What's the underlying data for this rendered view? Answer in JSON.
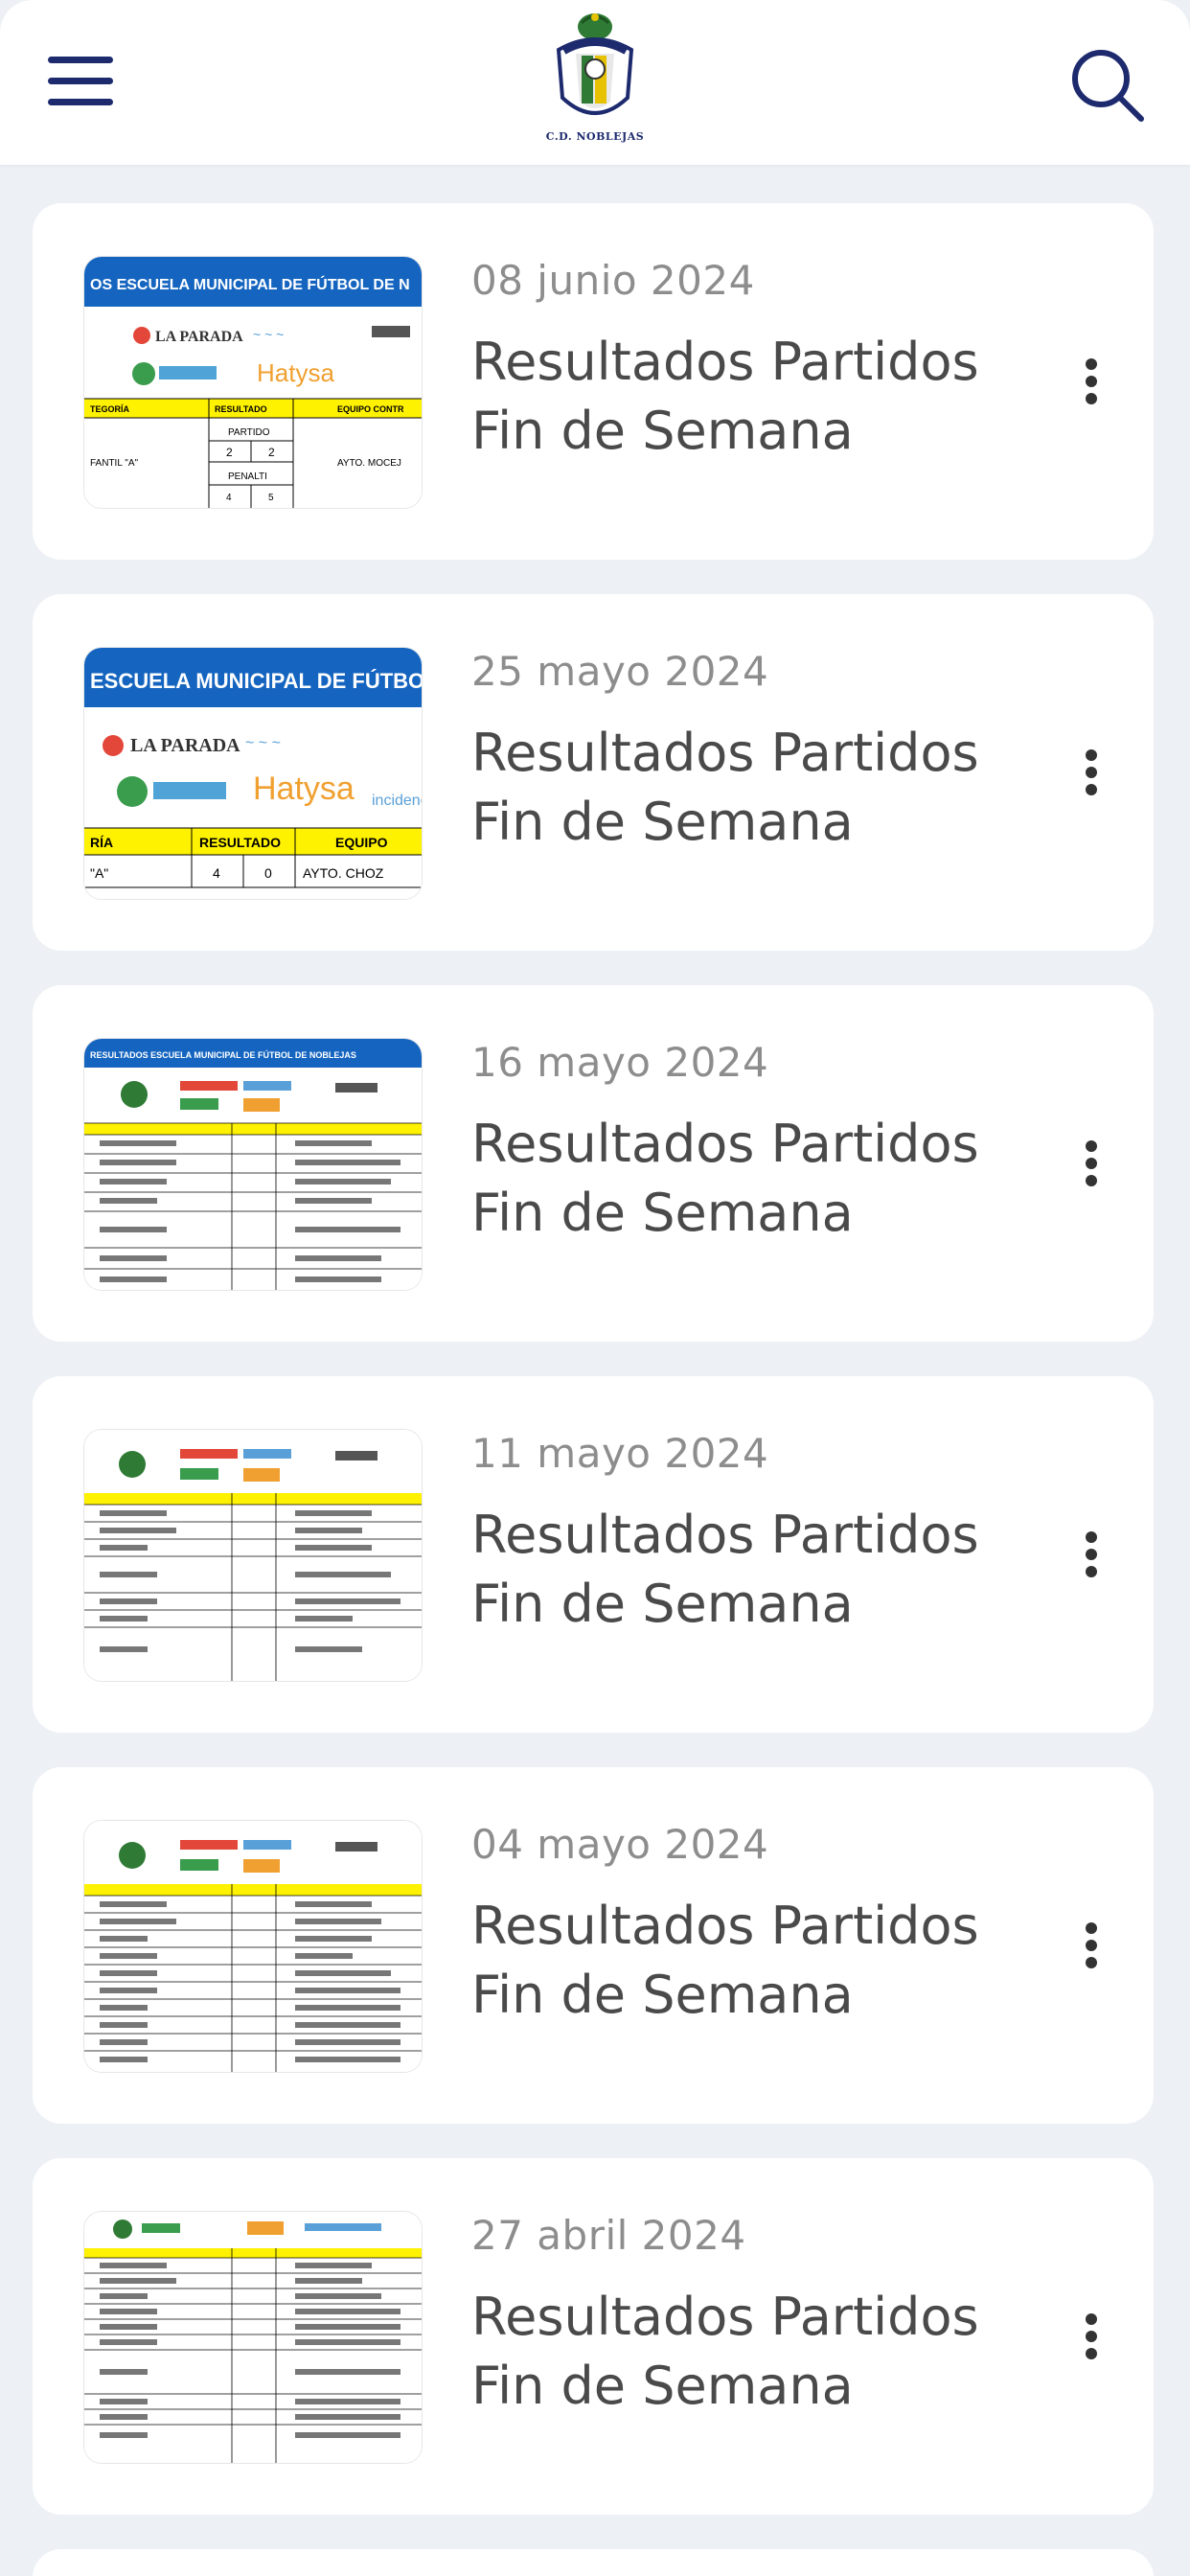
{
  "header": {
    "logo_caption": "C.D. NOBLEJAS",
    "menu_icon": "hamburger-menu-icon",
    "search_icon": "search-icon",
    "accent_color": "#1d2a6e"
  },
  "posts": [
    {
      "date": "08 junio 2024",
      "title": "Resultados Partidos Fin de Semana",
      "more_icon": "more-vert-icon"
    },
    {
      "date": "25 mayo 2024",
      "title": "Resultados Partidos Fin de Semana",
      "more_icon": "more-vert-icon"
    },
    {
      "date": "16 mayo 2024",
      "title": "Resultados Partidos Fin de Semana",
      "more_icon": "more-vert-icon"
    },
    {
      "date": "11 mayo 2024",
      "title": "Resultados Partidos Fin de Semana",
      "more_icon": "more-vert-icon"
    },
    {
      "date": "04 mayo 2024",
      "title": "Resultados Partidos Fin de Semana",
      "more_icon": "more-vert-icon"
    },
    {
      "date": "27 abril 2024",
      "title": "Resultados Partidos Fin de Semana",
      "more_icon": "more-vert-icon"
    }
  ],
  "thumbnails": [
    {
      "banner": "OS ESCUELA MUNICIPAL DE FÚTBOL DE N",
      "sponsor1": "LA PARADA",
      "sponsor2": "Hatysa",
      "col1": "TEGORÍA",
      "col2": "RESULTADO",
      "col3": "EQUIPO CONTR",
      "row1": "FANTIL \"A\"",
      "row1_opp": "AYTO. MOCEJ",
      "label_partido": "PARTIDO",
      "label_penalti": "PENALTI",
      "s1": "2",
      "s2": "2",
      "p1": "4",
      "p2": "5"
    },
    {
      "banner": "ESCUELA MUNICIPAL DE FÚTBOL",
      "sponsor1": "LA PARADA",
      "sponsor2": "Hatysa",
      "col1": "RÍA",
      "col2": "RESULTADO",
      "col3": "EQUIPO",
      "row1": "\"A\"",
      "row1_opp": "AYTO. CHOZ",
      "s1": "4",
      "s2": "0"
    },
    {
      "banner": "RESULTADOS ESCUELA MUNICIPAL DE FÚTBOL DE NOBLEJAS"
    },
    {
      "banner": ""
    },
    {
      "banner": ""
    },
    {
      "banner": ""
    }
  ]
}
